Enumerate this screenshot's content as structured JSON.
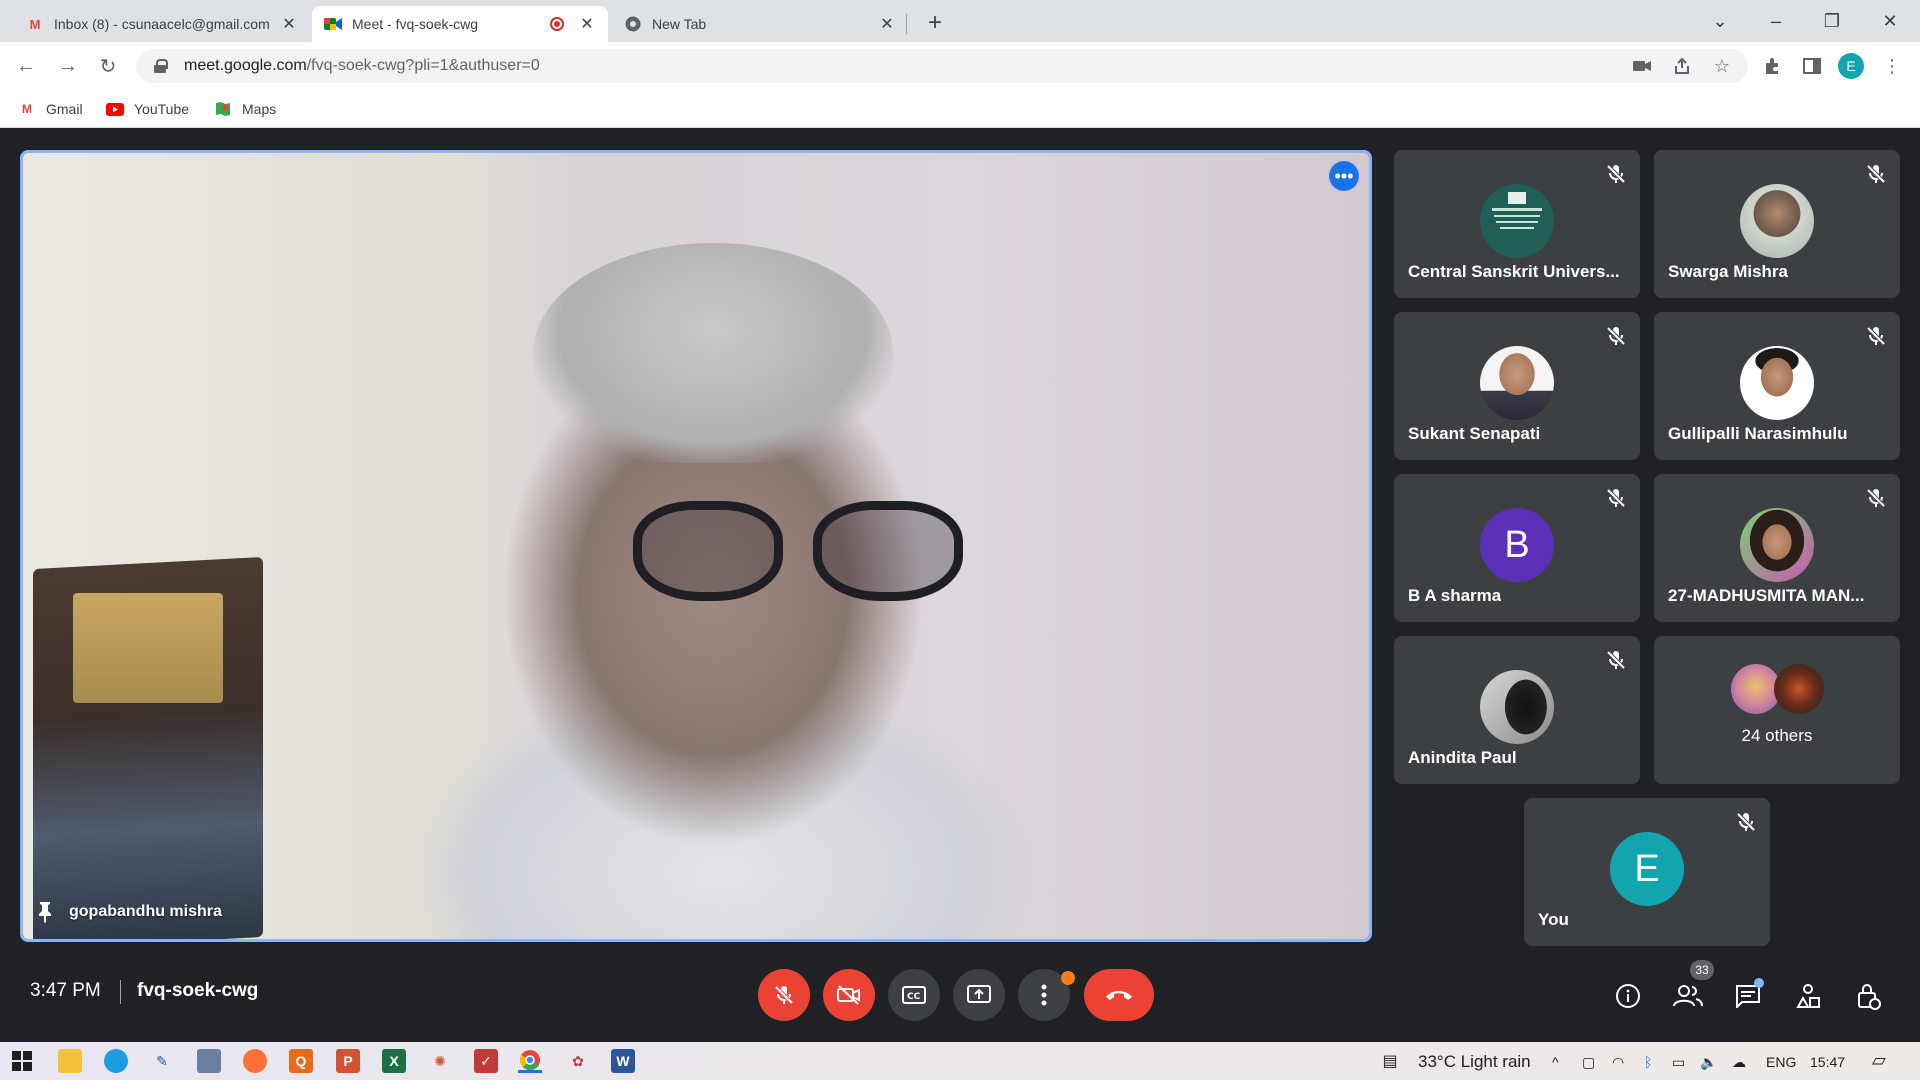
{
  "browser": {
    "tabs": [
      {
        "title": "Inbox (8) - csunaacelc@gmail.com",
        "active": false
      },
      {
        "title": "Meet - fvq-soek-cwg",
        "active": true
      },
      {
        "title": "New Tab",
        "active": false
      }
    ],
    "address": {
      "host": "meet.google.com",
      "path": "/fvq-soek-cwg?pli=1&authuser=0"
    },
    "profile_initial": "E",
    "bookmarks": [
      "Gmail",
      "YouTube",
      "Maps"
    ]
  },
  "meet": {
    "main_participant": {
      "name": "gopabandhu mishra"
    },
    "participants": [
      {
        "name": "Central Sanskrit Univers...",
        "avatar_type": "logo"
      },
      {
        "name": "Swarga Mishra",
        "avatar_type": "photo"
      },
      {
        "name": "Sukant Senapati",
        "avatar_type": "photo"
      },
      {
        "name": "Gullipalli Narasimhulu",
        "avatar_type": "photo"
      },
      {
        "name": "B A sharma",
        "avatar_type": "initial",
        "initial": "B",
        "color": "#5b2fb8"
      },
      {
        "name": "27-MADHUSMITA MAN...",
        "avatar_type": "photo"
      },
      {
        "name": "Anindita Paul",
        "avatar_type": "photo"
      }
    ],
    "others": {
      "label": "24 others"
    },
    "self_tile": {
      "name": "You",
      "initial": "E",
      "color": "#12a4af"
    },
    "time": "3:47 PM",
    "meeting_code": "fvq-soek-cwg",
    "participant_count": "33"
  },
  "taskbar": {
    "weather": "33°C  Light rain",
    "lang": "ENG",
    "clock": "15:47"
  },
  "colors": {
    "accent": "#1a73e8",
    "danger": "#ea4335",
    "tile": "#3c4043",
    "bg": "#202124"
  }
}
